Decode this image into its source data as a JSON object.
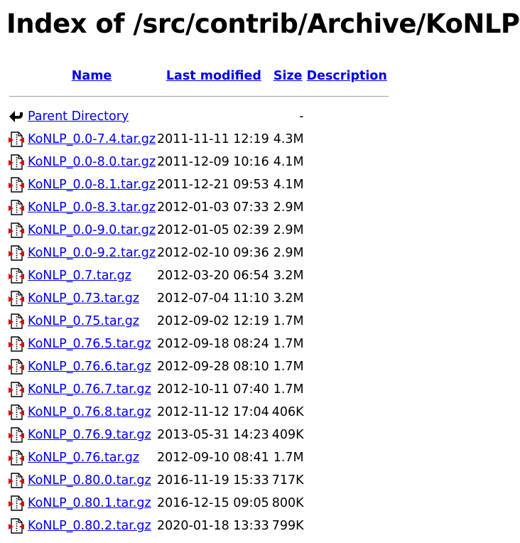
{
  "page": {
    "title": "Index of /src/contrib/Archive/KoNLP"
  },
  "table": {
    "headers": {
      "name": "Name",
      "last_modified": "Last modified",
      "size": "Size",
      "description": "Description"
    },
    "parent": {
      "name": "Parent Directory",
      "last_modified": "",
      "size": "-",
      "icon": "back-icon"
    },
    "rows": [
      {
        "name": "KoNLP_0.0-7.4.tar.gz",
        "last_modified": "2011-11-11 12:19",
        "size": "4.3M",
        "icon": "compressed-file-icon"
      },
      {
        "name": "KoNLP_0.0-8.0.tar.gz",
        "last_modified": "2011-12-09 10:16",
        "size": "4.1M",
        "icon": "compressed-file-icon"
      },
      {
        "name": "KoNLP_0.0-8.1.tar.gz",
        "last_modified": "2011-12-21 09:53",
        "size": "4.1M",
        "icon": "compressed-file-icon"
      },
      {
        "name": "KoNLP_0.0-8.3.tar.gz",
        "last_modified": "2012-01-03 07:33",
        "size": "2.9M",
        "icon": "compressed-file-icon"
      },
      {
        "name": "KoNLP_0.0-9.0.tar.gz",
        "last_modified": "2012-01-05 02:39",
        "size": "2.9M",
        "icon": "compressed-file-icon"
      },
      {
        "name": "KoNLP_0.0-9.2.tar.gz",
        "last_modified": "2012-02-10 09:36",
        "size": "2.9M",
        "icon": "compressed-file-icon"
      },
      {
        "name": "KoNLP_0.7.tar.gz",
        "last_modified": "2012-03-20 06:54",
        "size": "3.2M",
        "icon": "compressed-file-icon"
      },
      {
        "name": "KoNLP_0.73.tar.gz",
        "last_modified": "2012-07-04 11:10",
        "size": "3.2M",
        "icon": "compressed-file-icon"
      },
      {
        "name": "KoNLP_0.75.tar.gz",
        "last_modified": "2012-09-02 12:19",
        "size": "1.7M",
        "icon": "compressed-file-icon"
      },
      {
        "name": "KoNLP_0.76.5.tar.gz",
        "last_modified": "2012-09-18 08:24",
        "size": "1.7M",
        "icon": "compressed-file-icon"
      },
      {
        "name": "KoNLP_0.76.6.tar.gz",
        "last_modified": "2012-09-28 08:10",
        "size": "1.7M",
        "icon": "compressed-file-icon"
      },
      {
        "name": "KoNLP_0.76.7.tar.gz",
        "last_modified": "2012-10-11 07:40",
        "size": "1.7M",
        "icon": "compressed-file-icon"
      },
      {
        "name": "KoNLP_0.76.8.tar.gz",
        "last_modified": "2012-11-12 17:04",
        "size": "406K",
        "icon": "compressed-file-icon"
      },
      {
        "name": "KoNLP_0.76.9.tar.gz",
        "last_modified": "2013-05-31 14:23",
        "size": "409K",
        "icon": "compressed-file-icon"
      },
      {
        "name": "KoNLP_0.76.tar.gz",
        "last_modified": "2012-09-10 08:41",
        "size": "1.7M",
        "icon": "compressed-file-icon"
      },
      {
        "name": "KoNLP_0.80.0.tar.gz",
        "last_modified": "2016-11-19 15:33",
        "size": "717K",
        "icon": "compressed-file-icon"
      },
      {
        "name": "KoNLP_0.80.1.tar.gz",
        "last_modified": "2016-12-15 09:05",
        "size": "800K",
        "icon": "compressed-file-icon"
      },
      {
        "name": "KoNLP_0.80.2.tar.gz",
        "last_modified": "2020-01-18 13:33",
        "size": "799K",
        "icon": "compressed-file-icon"
      }
    ]
  },
  "colors": {
    "link": "#0000ee",
    "rule": "#a0a0a0",
    "icon_accent": "#e00000"
  }
}
